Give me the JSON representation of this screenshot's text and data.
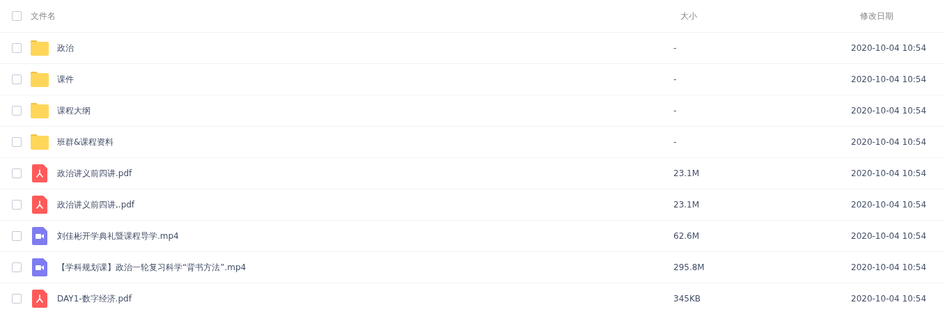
{
  "header": {
    "checked": false,
    "columns": [
      "文件名",
      "大小",
      "修改日期"
    ]
  },
  "files": [
    {
      "kind": "folder",
      "name": "政治",
      "size": "-",
      "modified": "2020-10-04 10:54",
      "checked": false
    },
    {
      "kind": "folder",
      "name": "课件",
      "size": "-",
      "modified": "2020-10-04 10:54",
      "checked": false
    },
    {
      "kind": "folder",
      "name": "课程大纲",
      "size": "-",
      "modified": "2020-10-04 10:54",
      "checked": false
    },
    {
      "kind": "folder",
      "name": "班群&课程资料",
      "size": "-",
      "modified": "2020-10-04 10:54",
      "checked": false
    },
    {
      "kind": "pdf",
      "name": "政治讲义前四讲.pdf",
      "size": "23.1M",
      "modified": "2020-10-04 10:54",
      "checked": false
    },
    {
      "kind": "pdf",
      "name": "政治讲义前四讲,.pdf",
      "size": "23.1M",
      "modified": "2020-10-04 10:54",
      "checked": false
    },
    {
      "kind": "video",
      "name": "刘佳彬开学典礼暨课程导学.mp4",
      "size": "62.6M",
      "modified": "2020-10-04 10:54",
      "checked": false
    },
    {
      "kind": "video",
      "name": "【学科规划课】政治一轮复习科学“背书方法”.mp4",
      "size": "295.8M",
      "modified": "2020-10-04 10:54",
      "checked": false
    },
    {
      "kind": "pdf",
      "name": "DAY1-数字经济.pdf",
      "size": "345KB",
      "modified": "2020-10-04 10:54",
      "checked": false
    }
  ]
}
